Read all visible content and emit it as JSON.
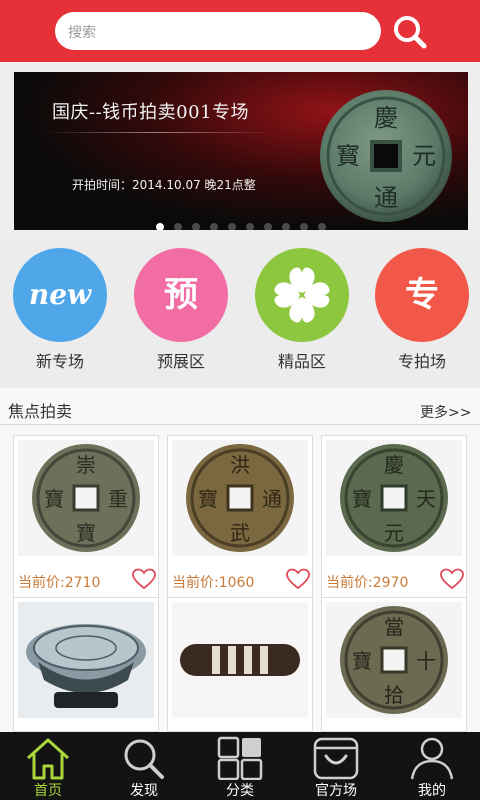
{
  "header": {
    "search_placeholder": "搜索"
  },
  "banner": {
    "title": "国庆--钱币拍卖001专场",
    "time_label": "开拍时间：2014.10.07 晚21点整",
    "coin_chars": [
      "慶",
      "元",
      "通",
      "寳"
    ],
    "dots_count": 10,
    "active_dot": 0
  },
  "categories": [
    {
      "icon_text": "new",
      "label": "新专场",
      "color": "#4fa7ea"
    },
    {
      "icon_text": "预",
      "label": "预展区",
      "color": "#f16da4"
    },
    {
      "icon": "clover-icon",
      "label": "精品区",
      "color": "#8dc63f"
    },
    {
      "icon_text": "专",
      "label": "专拍场",
      "color": "#f2584a"
    }
  ],
  "focus": {
    "title": "焦点拍卖",
    "more": "更多>>",
    "items": [
      {
        "price": "当前价:2710",
        "image": "bronze coin"
      },
      {
        "price": "当前价:1060",
        "image": "bronze coin"
      },
      {
        "price": "当前价:2970",
        "image": "bronze coin"
      },
      {
        "price": "",
        "image": "porcelain dish"
      },
      {
        "price": "",
        "image": "dzi bead"
      },
      {
        "price": "",
        "image": "bronze coin"
      }
    ]
  },
  "tabbar": {
    "items": [
      {
        "label": "首页",
        "icon": "home-icon",
        "active": true
      },
      {
        "label": "发现",
        "icon": "search-icon",
        "active": false
      },
      {
        "label": "分类",
        "icon": "grid-icon",
        "active": false
      },
      {
        "label": "官方场",
        "icon": "shop-icon",
        "active": false
      },
      {
        "label": "我的",
        "icon": "user-icon",
        "active": false
      }
    ]
  },
  "colors": {
    "brand_red": "#e63139",
    "active_tab": "#a8d63b",
    "price": "#c97a36",
    "heart": "#e24a5a"
  }
}
